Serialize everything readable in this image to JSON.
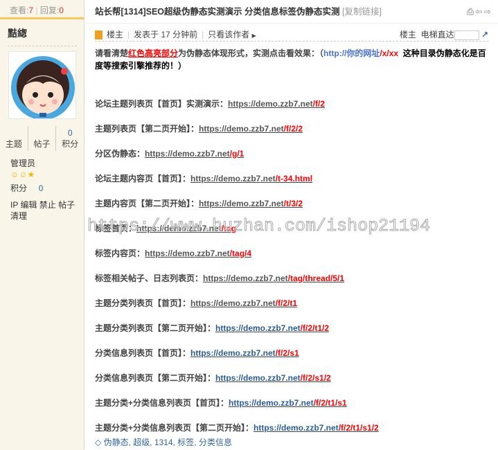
{
  "stats": {
    "views_label": "查看:",
    "views": "7",
    "replies_label": "回复:",
    "replies": "0"
  },
  "author": {
    "name": "黠緫",
    "topics_label": "主题",
    "posts_label": "帖子",
    "points_value": "0",
    "points_label": "积分",
    "group": "管理员",
    "points_row_label": "积分",
    "points_row_value": "0",
    "actions": "IP 编辑 禁止 帖子 清理"
  },
  "thread": {
    "title": "站长帮[1314]SEO超级伪静态实测演示 分类信息标签伪静态实测",
    "copy_link": "[复制链接]"
  },
  "meta": {
    "owner": "楼主",
    "posted": "发表于 17 分钟前",
    "only_author": "只看该作者",
    "floor": "楼主",
    "jump_label": "电梯直达"
  },
  "intro": {
    "p1": "请看清楚",
    "red": "红色高亮部分",
    "p2": "为伪静态体现形式，实测点击看效果：（",
    "url_base": "http://你的网址",
    "url_path": "/x/xx",
    "p3": "这种目录伪静态化是百度等搜索引擎推荐的！）"
  },
  "rows": [
    {
      "label": "论坛主题列表页【首页】实测演示：",
      "base": "https://demo.zzb7.net",
      "path": "/f/2"
    },
    {
      "label": "主题列表页【第二页开始】：",
      "base": "https://demo.zzb7.net",
      "path": "/f/2/2"
    },
    {
      "label": "分区伪静态：",
      "base": "https://demo.zzb7.net",
      "path": "/g/1"
    },
    {
      "label": "论坛主题内容页【首页】：",
      "base": "https://demo.zzb7.net",
      "path": "/t-34.html"
    },
    {
      "label": "主题内容页【第二页开始】：",
      "base": "https://demo.zzb7.net",
      "path": "/t/3/2"
    },
    {
      "label": "标签首页：",
      "base": "https://demo.zzb7.net",
      "path": "/tag"
    },
    {
      "label": "标签内容页：",
      "base": "https://demo.zzb7.net",
      "path": "/tag/4"
    },
    {
      "label": "标签相关帖子、日志列表页：",
      "base": "https://demo.zzb7.net",
      "path": "/tag/thread/5/1"
    },
    {
      "label": "主题分类列表页【首页】：",
      "base": "https://demo.zzb7.net",
      "path": "/f/2/t1"
    },
    {
      "label": "主题分类列表页【第二页开始】：",
      "base": "https://demo.zzb7.net",
      "path": "/f/2/t1/2"
    },
    {
      "label": "分类信息列表页【首页】：",
      "base": "https://demo.zzb7.net",
      "path": "/f/2/s1"
    },
    {
      "label": "分类信息列表页【第二页开始】：",
      "base": "https://demo.zzb7.net",
      "path": "/f/2/s1/2"
    },
    {
      "label": "主题分类+分类信息列表页【首页】：",
      "base": "https://demo.zzb7.net",
      "path": "/f/2/t1/s1"
    },
    {
      "label": "主题分类+分类信息列表页【第二页开始】：",
      "base": "https://demo.zzb7.net",
      "path": "/f/2/t1/s1/2"
    }
  ],
  "tags": "伪静态, 超级, 1314, 标签, 分类信息",
  "watermark": "https://www.huzhan.com/ishop21194"
}
